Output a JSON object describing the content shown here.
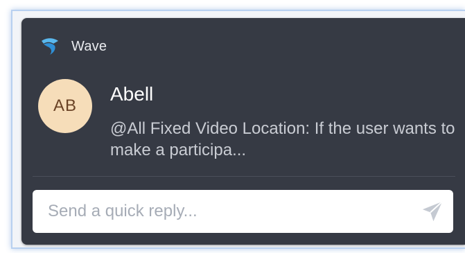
{
  "app": {
    "name": "Wave",
    "logo_icon": "wave-logo-icon",
    "brand_color": "#3fa6e6"
  },
  "notification": {
    "avatar_initials": "AB",
    "avatar_color": "#f6ddb9",
    "sender": "Abell",
    "message": "@All Fixed Video Location: If the user wants to make a participa..."
  },
  "reply": {
    "placeholder": "Send a quick reply...",
    "value": "",
    "send_icon": "send-icon"
  }
}
